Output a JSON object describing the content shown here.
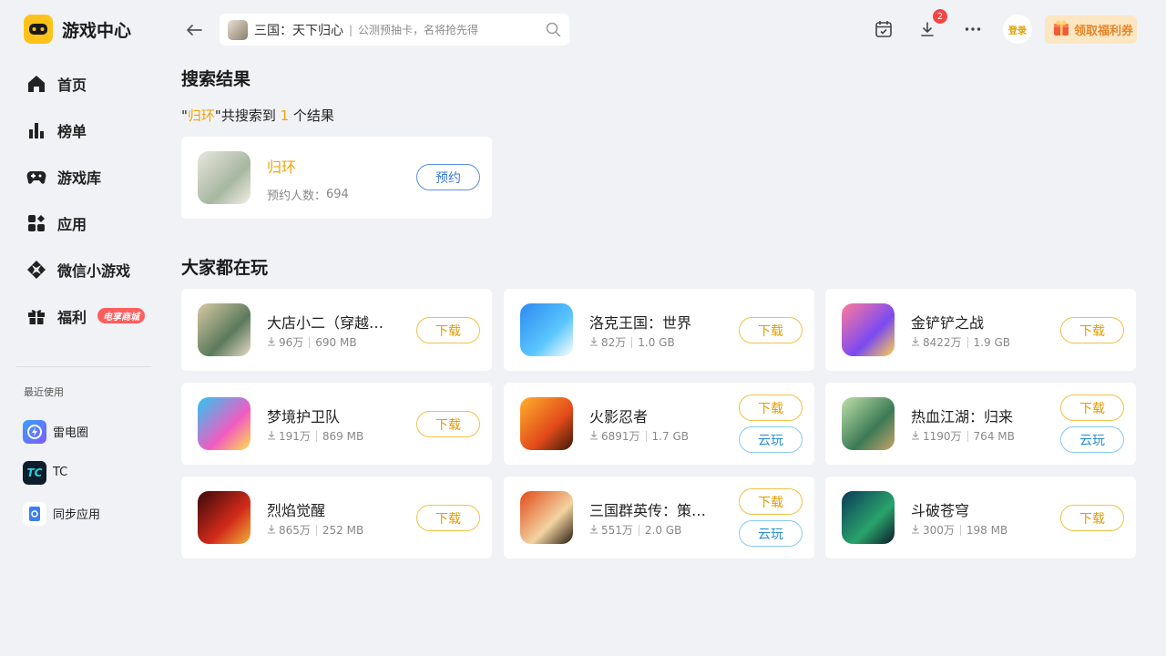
{
  "app": {
    "title": "游戏中心"
  },
  "sidebar": {
    "items": [
      {
        "label": "首页",
        "icon": "home-icon"
      },
      {
        "label": "榜单",
        "icon": "ranking-icon"
      },
      {
        "label": "游戏库",
        "icon": "gamepad-icon"
      },
      {
        "label": "应用",
        "icon": "apps-icon"
      },
      {
        "label": "微信小游戏",
        "icon": "mini-game-icon"
      },
      {
        "label": "福利",
        "icon": "gift-icon",
        "badge": "电享商城"
      }
    ],
    "recent_title": "最近使用",
    "recent": [
      {
        "label": "雷电圈"
      },
      {
        "label": "TC"
      },
      {
        "label": "同步应用"
      }
    ]
  },
  "topbar": {
    "search": {
      "main": "三国：天下归心",
      "sub": "公测预抽卡，名将抢先得"
    },
    "download_badge": "2",
    "login": "登录",
    "coupon": "领取福利券"
  },
  "search_results": {
    "title": "搜索结果",
    "summary": {
      "quote_open": "\"",
      "keyword": "归环",
      "quote_close": "\"",
      "prefix": "共搜索到 ",
      "count": "1",
      "suffix": " 个结果"
    },
    "result": {
      "name": "归环",
      "meta_label": "预约人数：",
      "meta_value": "694",
      "action": "预约"
    }
  },
  "popular": {
    "title": "大家都在玩",
    "download_label": "下载",
    "cloud_label": "云玩",
    "games": [
      {
        "name": "大店小二（穿越经营）",
        "downloads": "96万",
        "size": "690 MB",
        "cloud": false
      },
      {
        "name": "洛克王国：世界",
        "downloads": "82万",
        "size": "1.0 GB",
        "cloud": false
      },
      {
        "name": "金铲铲之战",
        "downloads": "8422万",
        "size": "1.9 GB",
        "cloud": false
      },
      {
        "name": "梦境护卫队",
        "downloads": "191万",
        "size": "869 MB",
        "cloud": false
      },
      {
        "name": "火影忍者",
        "downloads": "6891万",
        "size": "1.7 GB",
        "cloud": true
      },
      {
        "name": "热血江湖：归来",
        "downloads": "1190万",
        "size": "764 MB",
        "cloud": true
      },
      {
        "name": "烈焰觉醒",
        "downloads": "865万",
        "size": "252 MB",
        "cloud": false
      },
      {
        "name": "三国群英传：策定九州",
        "downloads": "551万",
        "size": "2.0 GB",
        "cloud": true
      },
      {
        "name": "斗破苍穹",
        "downloads": "300万",
        "size": "198 MB",
        "cloud": false
      }
    ]
  },
  "colors": {
    "accent": "#f0a400",
    "background": "#f1f2f6",
    "badge_red": "#f24646"
  }
}
